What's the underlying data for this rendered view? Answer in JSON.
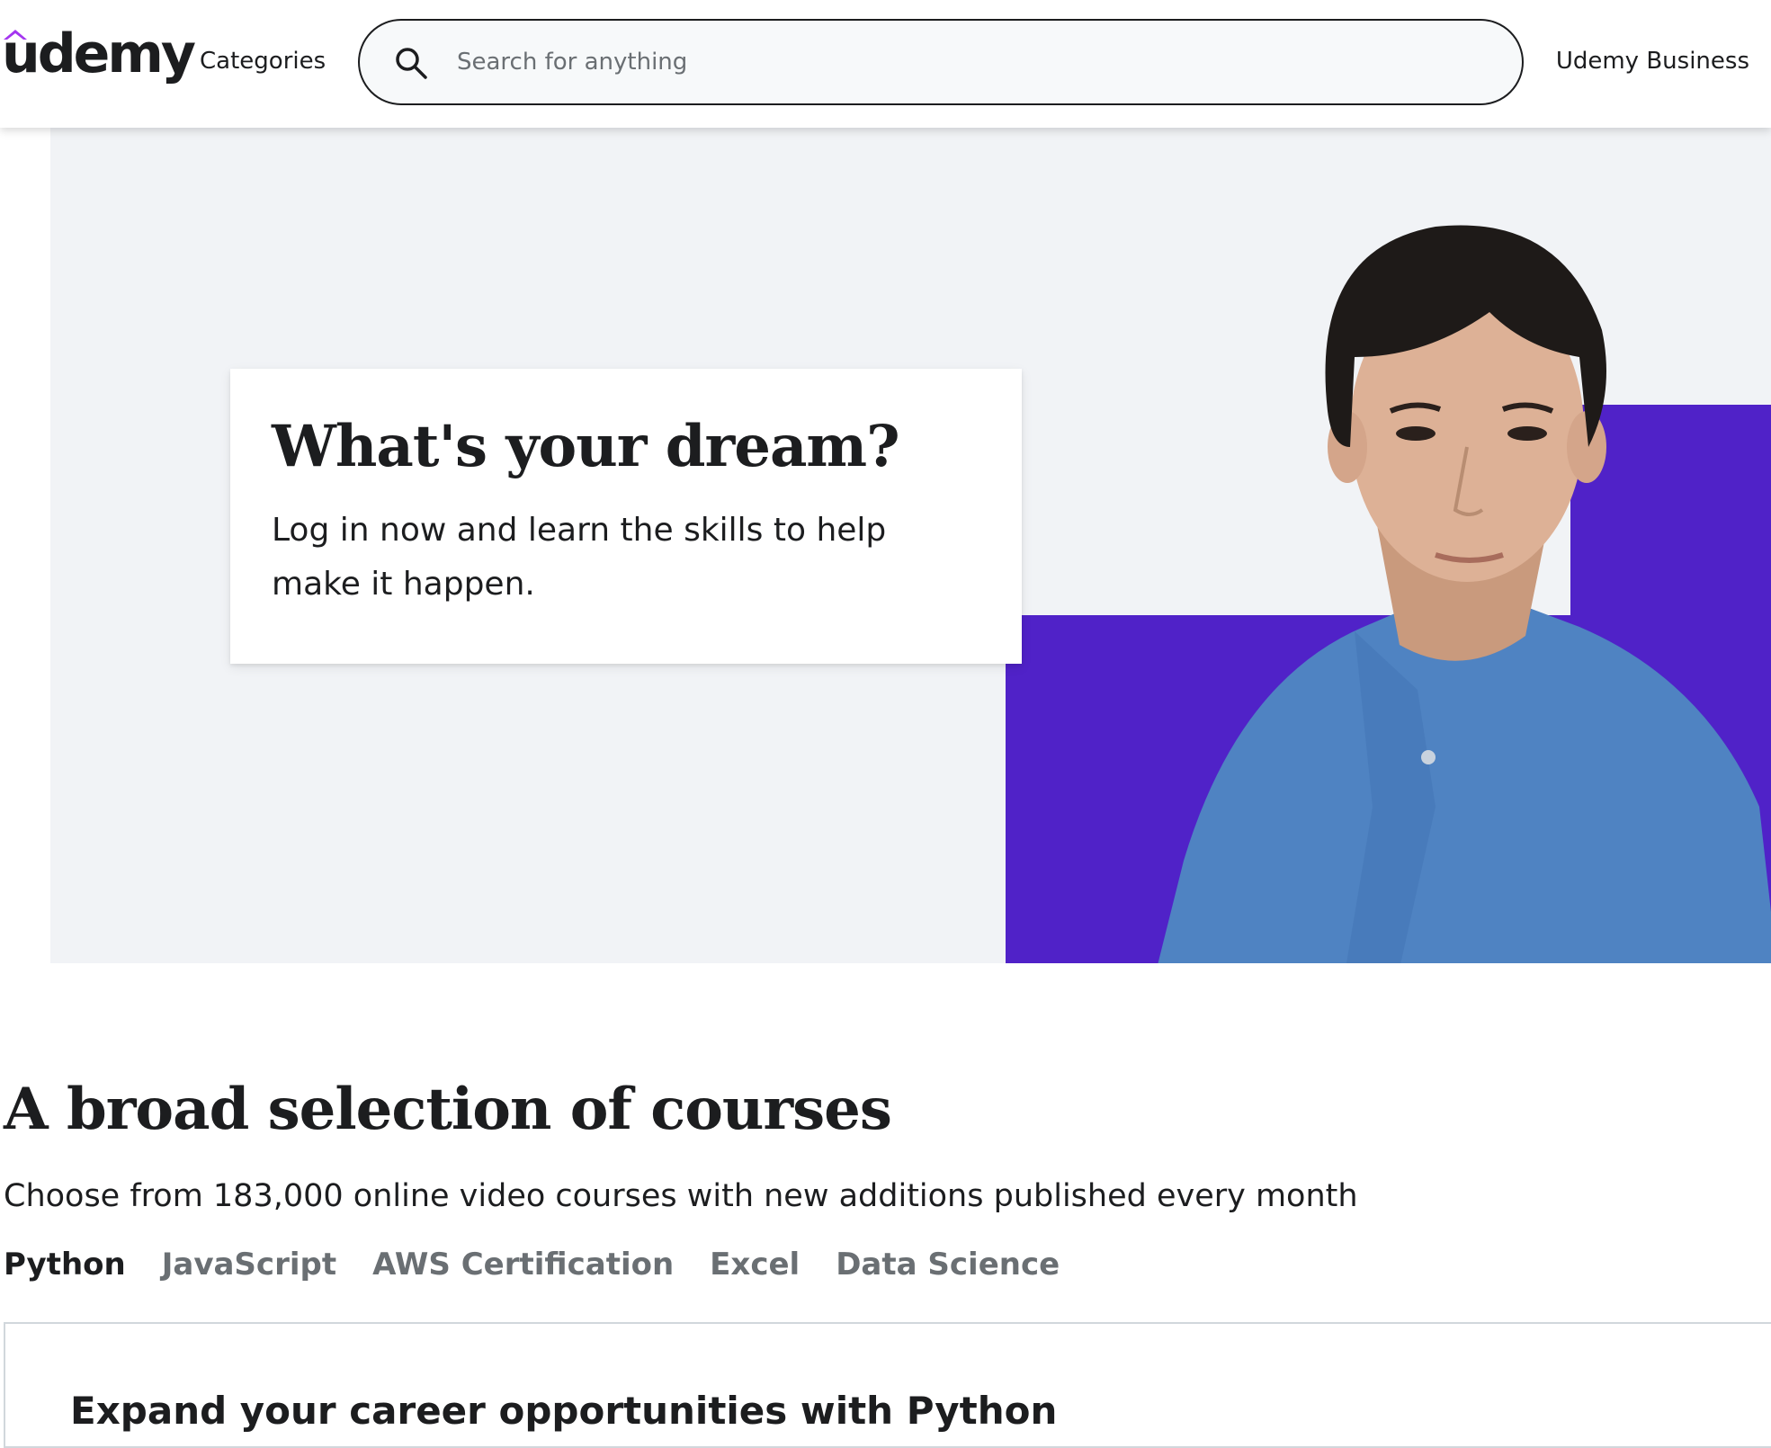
{
  "header": {
    "logo_text": "udemy",
    "categories_label": "Categories",
    "search_placeholder": "Search for anything",
    "business_label": "Udemy Business"
  },
  "hero": {
    "title": "What's your dream?",
    "subtitle": "Log in now and learn the skills to help make it happen."
  },
  "courses": {
    "title": "A broad selection of courses",
    "subtitle": "Choose from 183,000 online video courses with new additions published every month",
    "tabs": [
      {
        "label": "Python",
        "active": true
      },
      {
        "label": "JavaScript",
        "active": false
      },
      {
        "label": "AWS Certification",
        "active": false
      },
      {
        "label": "Excel",
        "active": false
      },
      {
        "label": "Data Science",
        "active": false
      }
    ],
    "panel_heading": "Expand your career opportunities with Python"
  },
  "colors": {
    "brand_purple": "#a435f0",
    "hero_purple": "#5022c8",
    "text_dark": "#1c1d1f",
    "text_muted": "#6a6f73"
  },
  "icons": {
    "search": "search-icon",
    "logo": "udemy-logo-icon"
  }
}
